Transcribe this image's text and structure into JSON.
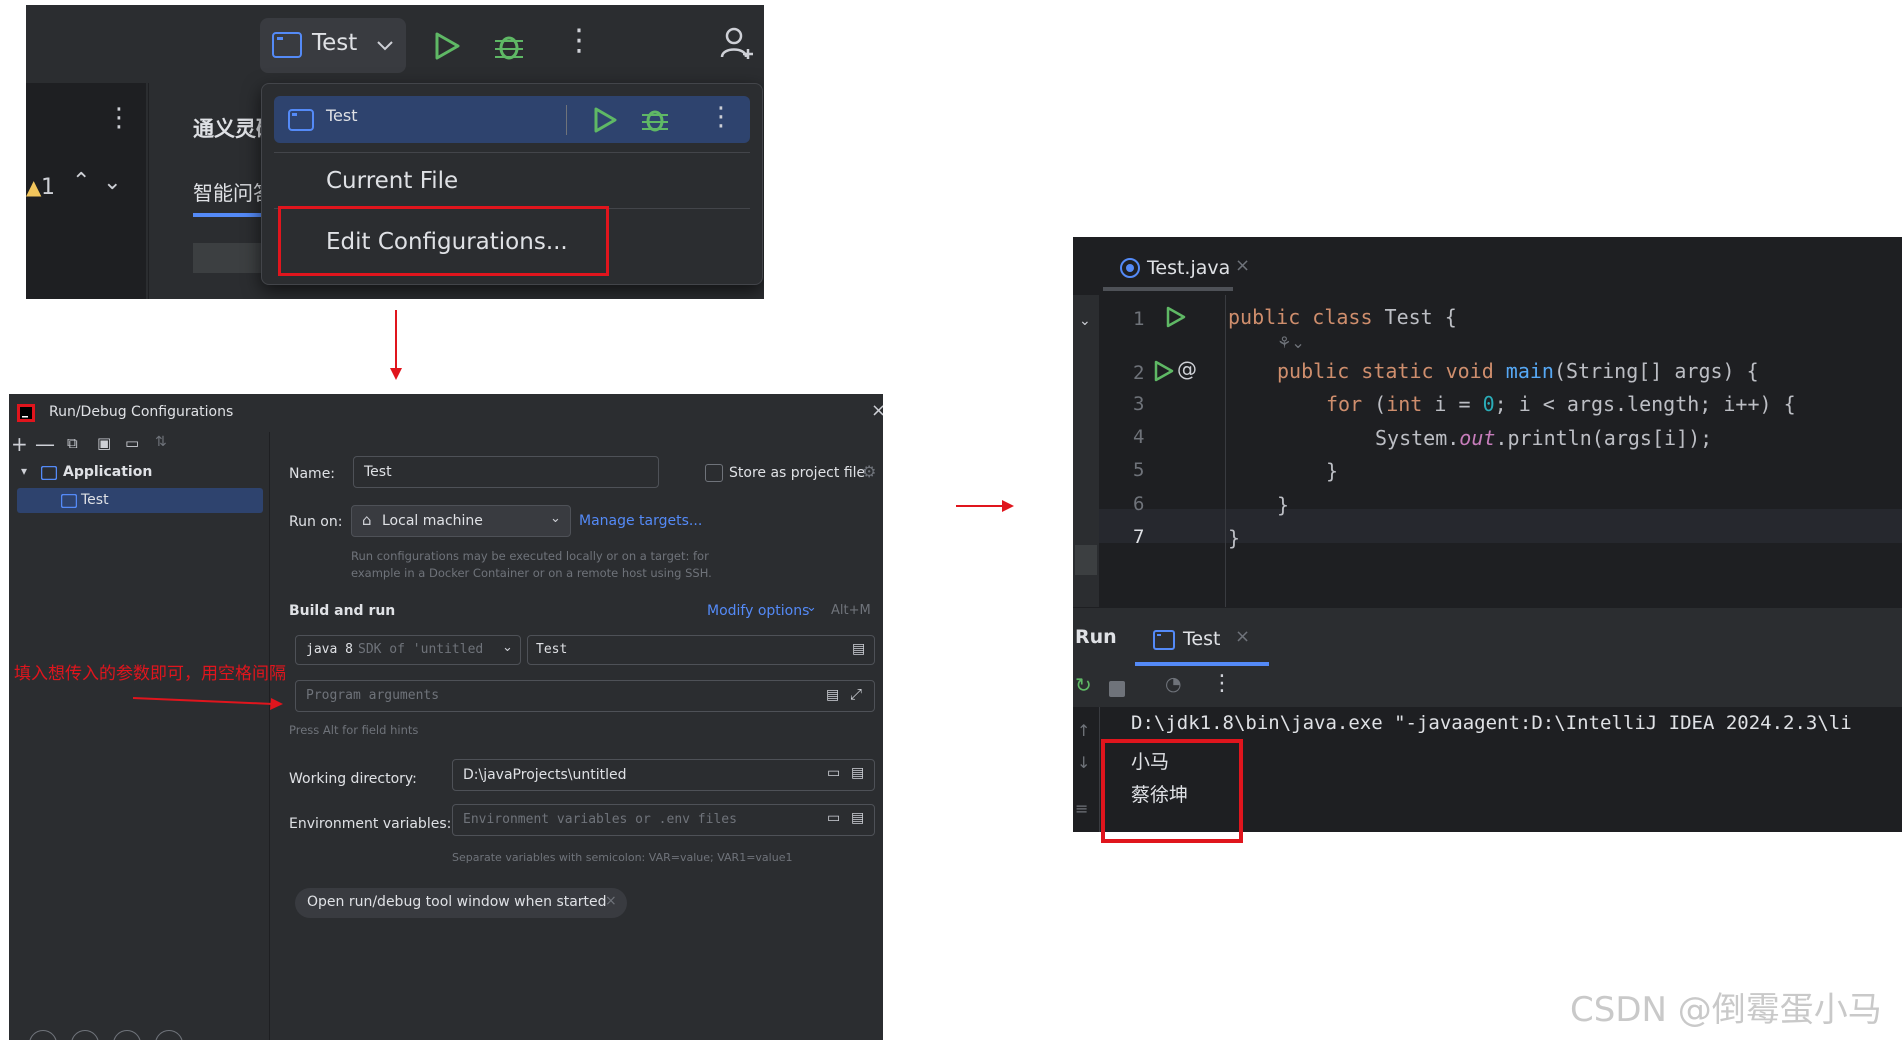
{
  "toolbar": {
    "config_name": "Test",
    "annotation_count": "1"
  },
  "left_panel": {
    "tool_window_title": "通义灵码",
    "tab_label": "智能问答"
  },
  "run_dropdown": {
    "selected_config": "Test",
    "items": [
      "Current File",
      "Edit Configurations..."
    ]
  },
  "dialog": {
    "title": "Run/Debug Configurations",
    "tree": {
      "group": "Application",
      "config": "Test"
    },
    "name_label": "Name:",
    "name_value": "Test",
    "store_label": "Store as project file",
    "run_on_label": "Run on:",
    "run_on_value": "Local machine",
    "manage_targets": "Manage targets...",
    "run_on_hint_1": "Run configurations may be executed locally or on a target: for",
    "run_on_hint_2": "example in a Docker Container or on a remote host using SSH.",
    "build_and_run": "Build and run",
    "modify_options": "Modify options",
    "modify_shortcut": "Alt+M",
    "jdk_value": "java 8",
    "jdk_suffix": "SDK of 'untitled",
    "main_class_value": "Test",
    "program_args_placeholder": "Program arguments",
    "field_hints": "Press Alt for field hints",
    "working_dir_label": "Working directory:",
    "working_dir_value": "D:\\javaProjects\\untitled",
    "env_label": "Environment variables:",
    "env_placeholder": "Environment variables or .env files",
    "env_hint": "Separate variables with semicolon: VAR=value; VAR1=value1",
    "open_tool_window_chip": "Open run/debug tool window when started"
  },
  "annotation_text": "填入想传入的参数即可，用空格间隔",
  "editor": {
    "tab_title": "Test.java",
    "line_numbers": [
      "1",
      "2",
      "3",
      "4",
      "5",
      "6",
      "7"
    ],
    "lines": {
      "l1_kw": "public class ",
      "l1_name": "Test ",
      "l1_brace": "{",
      "l2_kw": "public static void ",
      "l2_fn": "main",
      "l2_rest": "(String[] args) {",
      "l3_kw": "for ",
      "l3_a": "(",
      "l3_int": "int ",
      "l3_b": "i = ",
      "l3_zero": "0",
      "l3_c": "; i < args.length; i++) {",
      "l4_a": "System.",
      "l4_out": "out",
      "l4_b": ".println(args[i]);",
      "l5": "}",
      "l6": "}",
      "l7": "}"
    }
  },
  "run_window": {
    "title": "Run",
    "tab": "Test",
    "command": "D:\\jdk1.8\\bin\\java.exe \"-javaagent:D:\\IntelliJ IDEA 2024.2.3\\li",
    "output": [
      "小马",
      "蔡徐坤"
    ]
  },
  "watermark": "CSDN @倒霉蛋小马",
  "colors": {
    "annotation_red": "#e0151d",
    "ide_background": "#2b2d30",
    "selection_blue": "#2e436e",
    "run_green": "#5fb865",
    "link_blue": "#548af7"
  }
}
